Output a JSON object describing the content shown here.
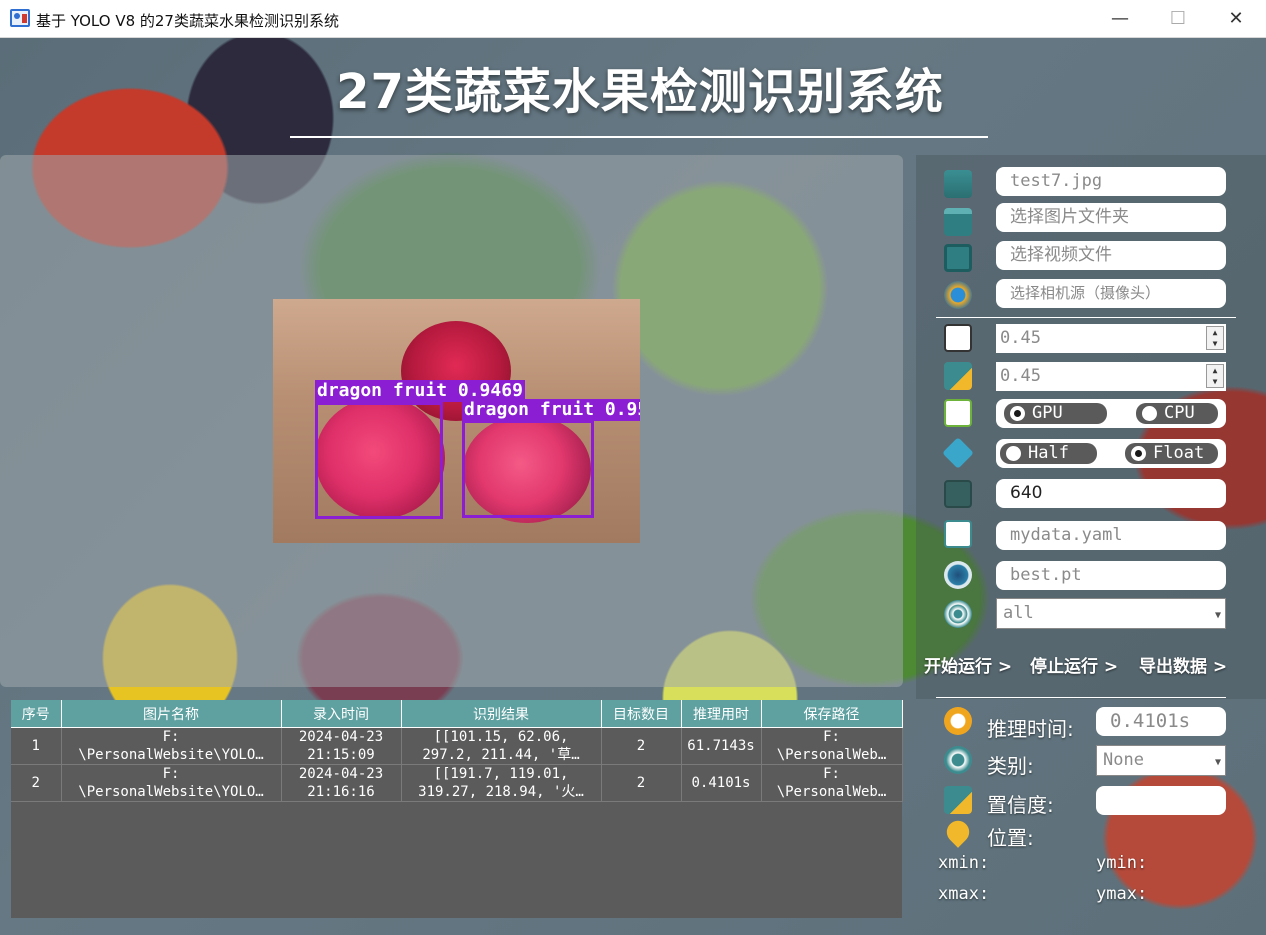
{
  "window": {
    "title": "基于 YOLO V8 的27类蔬菜水果检测识别系统",
    "minimize": "—",
    "maximize": "☐",
    "close": "✕"
  },
  "app_title": "27类蔬菜水果检测识别系统",
  "detections": [
    {
      "label": "dragon fruit 0.9469"
    },
    {
      "label": "dragon fruit 0.95"
    }
  ],
  "sources": {
    "image_file": "test7.jpg",
    "image_folder_placeholder": "选择图片文件夹",
    "video_file_placeholder": "选择视频文件",
    "camera_placeholder": "选择相机源（摄像头）"
  },
  "params": {
    "confidence": "0.45",
    "iou": "0.45",
    "device": {
      "gpu_label": "GPU",
      "cpu_label": "CPU",
      "selected": "CPU"
    },
    "precision": {
      "half_label": "Half",
      "float_label": "Float",
      "selected": "Float"
    },
    "img_size": "640",
    "data_yaml": "mydata.yaml",
    "weights": "best.pt",
    "class_filter": "all"
  },
  "actions": {
    "start": "开始运行 >",
    "stop": "停止运行 >",
    "export": "导出数据 >"
  },
  "info": {
    "infer_time_label": "推理时间:",
    "infer_time_value": "0.4101s",
    "class_label": "类别:",
    "class_value": "None",
    "conf_label": "置信度:",
    "conf_value": "",
    "position_label": "位置:",
    "xmin_label": "xmin:",
    "ymin_label": "ymin:",
    "xmax_label": "xmax:",
    "ymax_label": "ymax:"
  },
  "table": {
    "headers": [
      "序号",
      "图片名称",
      "录入时间",
      "识别结果",
      "目标数目",
      "推理用时",
      "保存路径"
    ],
    "rows": [
      [
        "1",
        "F:\n\\PersonalWebsite\\YOLO…",
        "2024-04-23\n21:15:09",
        "[[101.15, 62.06,\n297.2, 211.44, '草…",
        "2",
        "61.7143s",
        "F:\n\\PersonalWeb…"
      ],
      [
        "2",
        "F:\n\\PersonalWebsite\\YOLO…",
        "2024-04-23\n21:16:16",
        "[[191.7, 119.01,\n319.27, 218.94, '火…",
        "2",
        "0.4101s",
        "F:\n\\PersonalWeb…"
      ]
    ]
  },
  "colors": {
    "accent_teal": "#5fa0a0",
    "detection_box": "#8b1ed3",
    "table_bg": "#5b5b5b"
  },
  "icons": {
    "app": "app-icon",
    "image_file": "image-file-icon",
    "folder": "folder-icon",
    "video": "video-icon",
    "camera": "camera-icon",
    "confidence": "confidence-icon",
    "iou": "iou-icon",
    "gpu": "nvidia-gpu-icon",
    "precision": "cube-icon",
    "img_size": "image-size-icon",
    "yaml": "yaml-file-icon",
    "weights": "weights-icon",
    "class_filter": "target-icon",
    "timer": "timer-icon",
    "class": "class-icon",
    "confidence_info": "confidence-info-icon",
    "location": "location-pin-icon"
  }
}
